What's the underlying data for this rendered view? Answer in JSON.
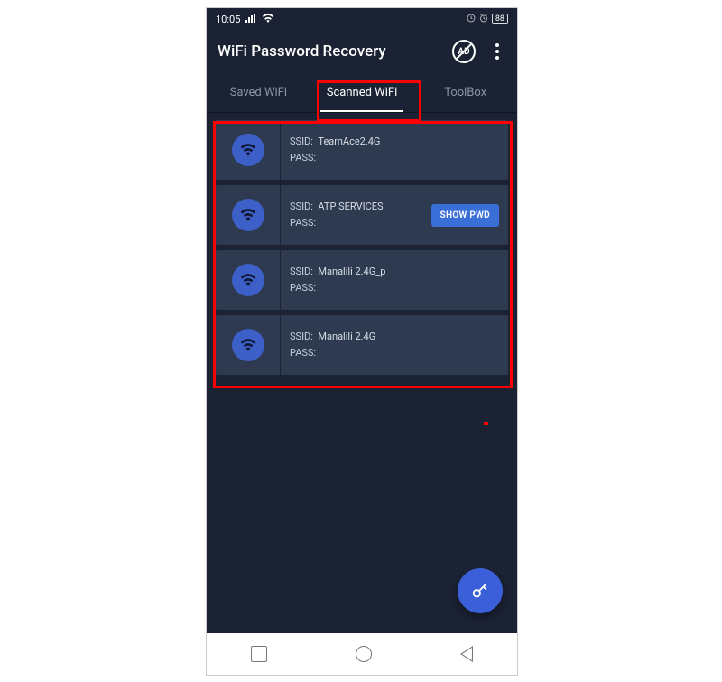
{
  "status": {
    "time": "10:05",
    "battery": "88"
  },
  "header": {
    "title": "WiFi Password Recovery",
    "ad_label": "AD"
  },
  "tabs": [
    {
      "label": "Saved WiFi",
      "active": false
    },
    {
      "label": "Scanned WiFi",
      "active": true
    },
    {
      "label": "ToolBox",
      "active": false
    }
  ],
  "labels": {
    "ssid": "SSID:",
    "pass": "PASS:",
    "show_pwd": "SHOW PWD"
  },
  "networks": [
    {
      "ssid": "TeamAce2.4G",
      "pass": "",
      "show_button": false
    },
    {
      "ssid": "ATP SERVICES",
      "pass": "",
      "show_button": true
    },
    {
      "ssid": "Manalili 2.4G_p",
      "pass": "",
      "show_button": false
    },
    {
      "ssid": "Manalili 2.4G",
      "pass": "",
      "show_button": false
    }
  ]
}
